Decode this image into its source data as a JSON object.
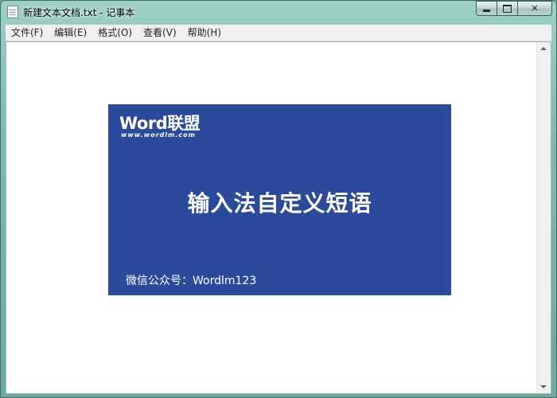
{
  "window": {
    "title": "新建文本文档.txt - 记事本",
    "minimize_icon": "minimize-icon",
    "maximize_icon": "maximize-icon",
    "close_icon": "close-icon",
    "close_glyph": "✕"
  },
  "menu": {
    "items": [
      {
        "label": "文件(F)"
      },
      {
        "label": "编辑(E)"
      },
      {
        "label": "格式(O)"
      },
      {
        "label": "查看(V)"
      },
      {
        "label": "帮助(H)"
      }
    ]
  },
  "banner": {
    "brand": "Word联盟",
    "brand_url": "www.wordlm.com",
    "headline": "输入法自定义短语",
    "footer": "微信公众号：Wordlm123",
    "background": "#2c4a9c"
  }
}
